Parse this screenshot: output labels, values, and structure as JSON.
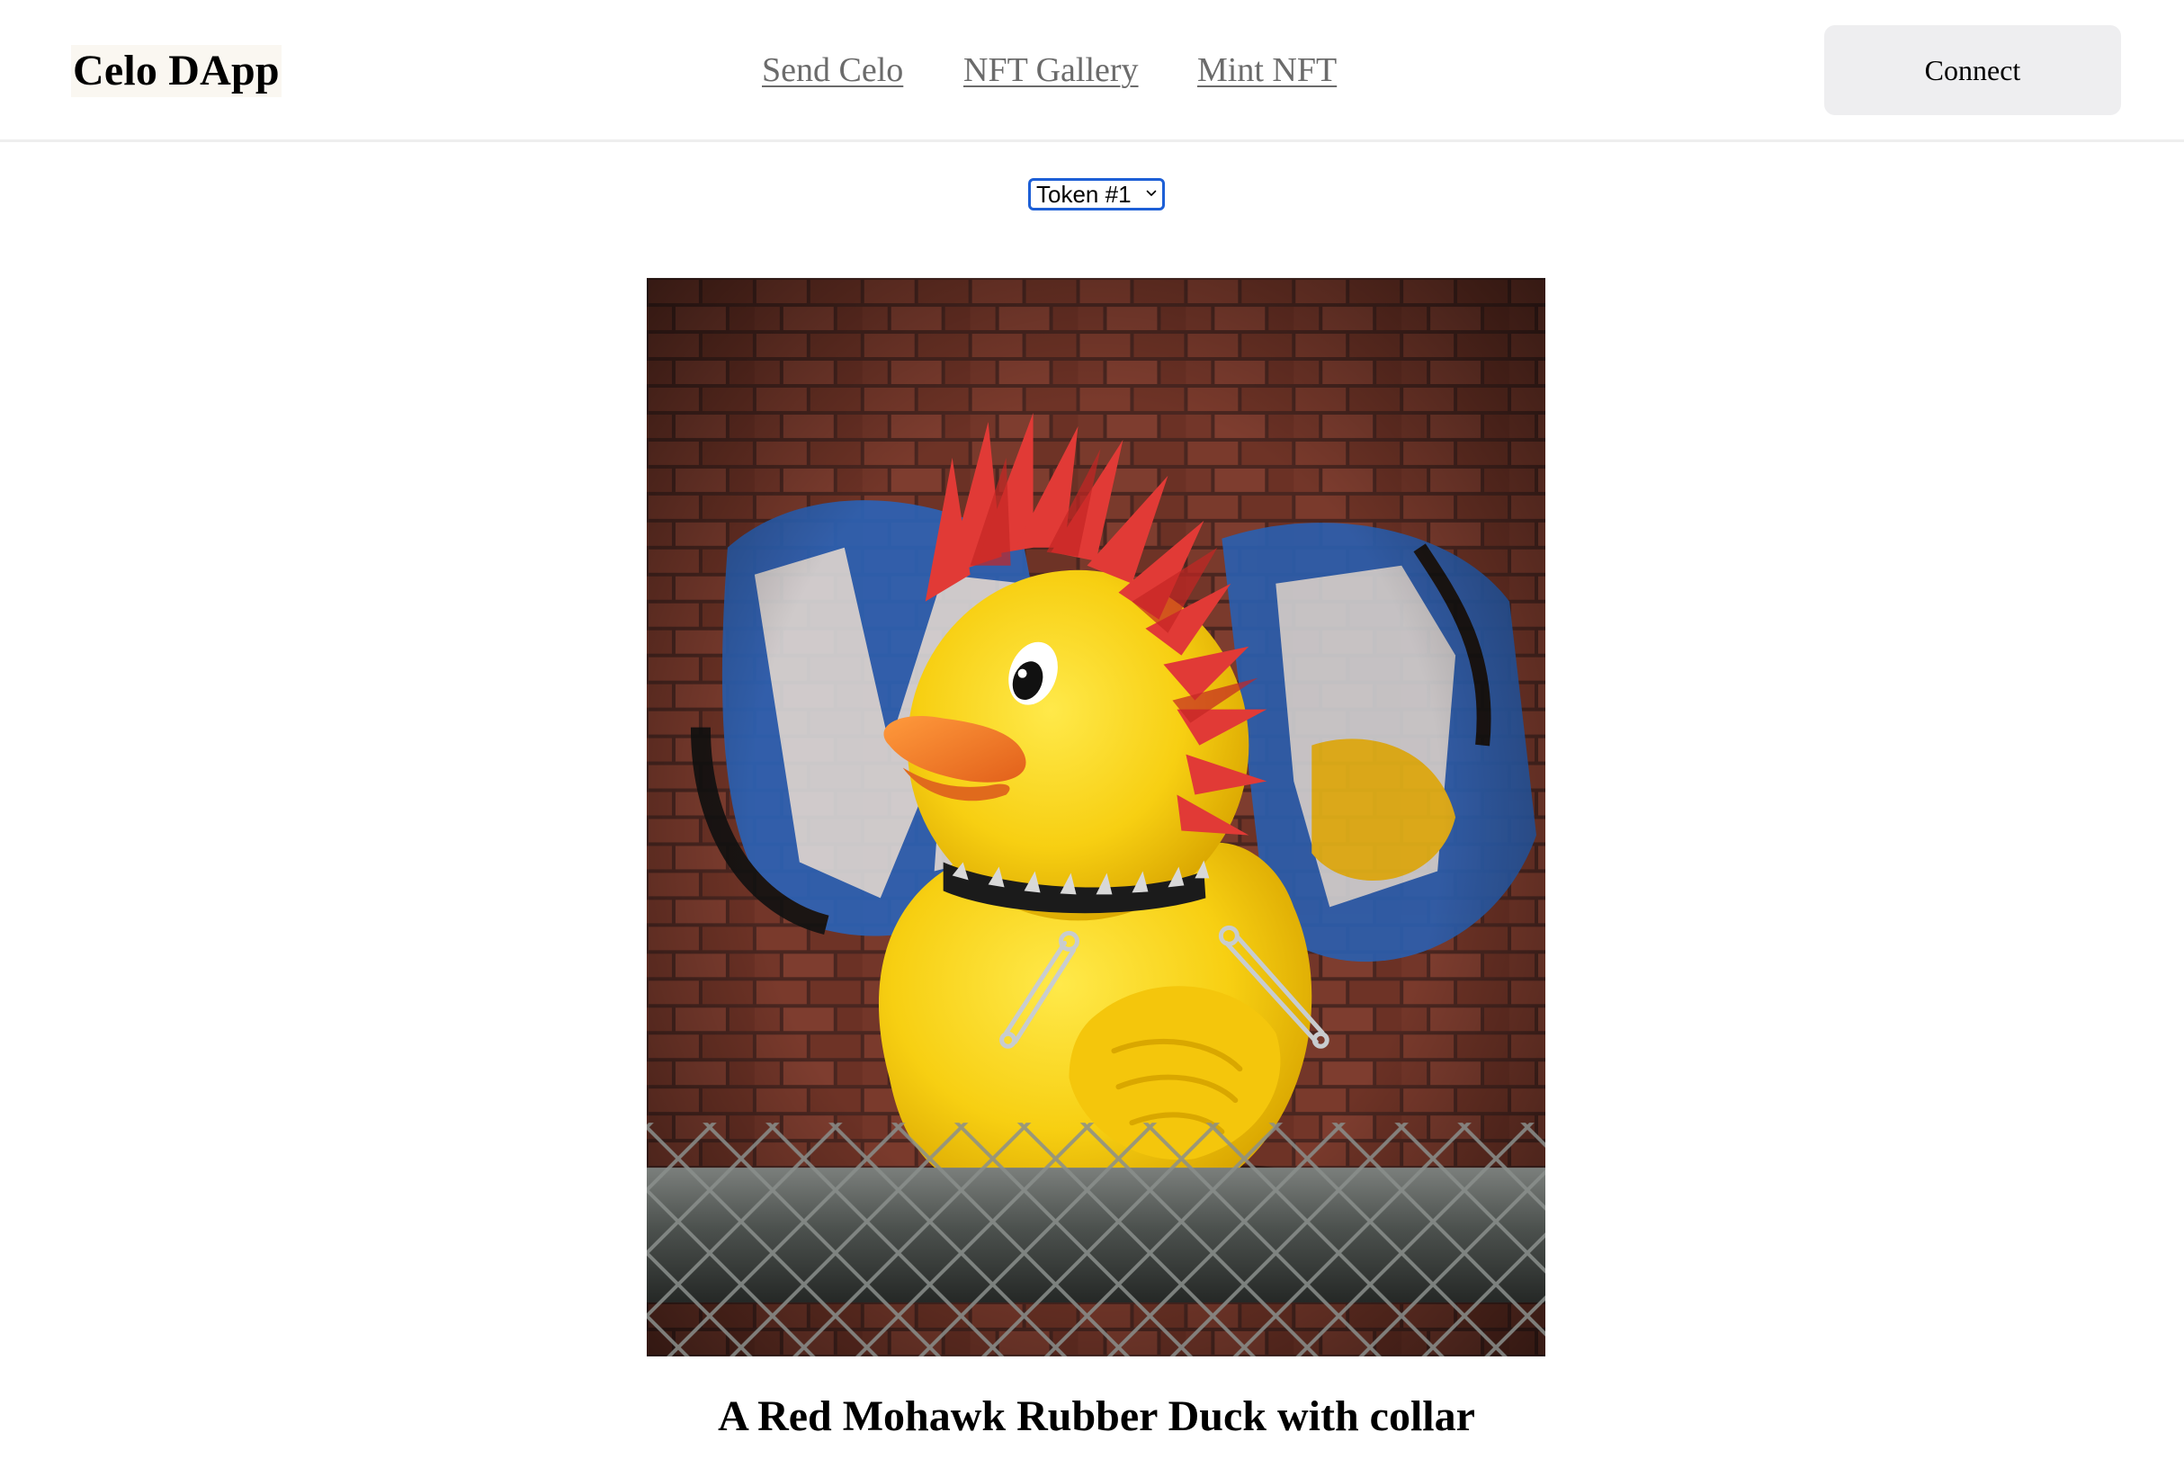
{
  "app": {
    "title": "Celo DApp"
  },
  "nav": {
    "items": [
      {
        "label": "Send Celo"
      },
      {
        "label": "NFT Gallery"
      },
      {
        "label": "Mint NFT"
      }
    ]
  },
  "header": {
    "connect_label": "Connect"
  },
  "token_select": {
    "selected": "Token #1"
  },
  "nft": {
    "title": "A Red Mohawk Rubber Duck with collar"
  },
  "colors": {
    "select_border": "#1d5fd6",
    "nav_link": "#6b6b6b",
    "connect_bg": "#eeeef0"
  }
}
